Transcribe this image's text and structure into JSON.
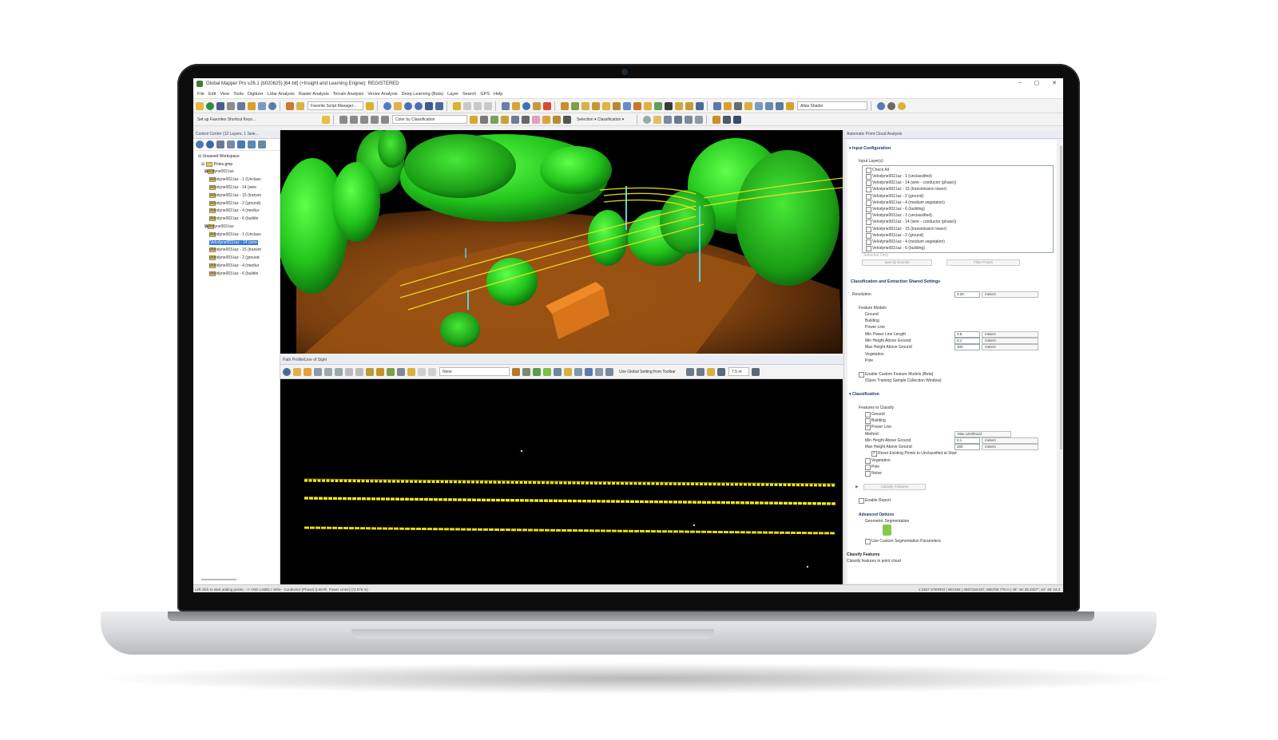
{
  "window": {
    "title": "Global Mapper Pro v26.1 (b020625) [64 bit] (+Insight and Learning Engine): REGISTERED",
    "controls": [
      "–",
      "▢",
      "✕"
    ]
  },
  "menu": [
    "File",
    "Edit",
    "View",
    "Tools",
    "Digitizer",
    "Lidar Analysis",
    "Raster Analysis",
    "Terrain Analysis",
    "Vector Analysis",
    "Deep Learning (Beta)",
    "Layer",
    "Search",
    "GPS",
    "Help"
  ],
  "toolbar": {
    "script_manager": "Favorite Script Manager...",
    "shortcut_keys": "Set up Favorites Shortcut Keys...",
    "color_by": "Color by Classification",
    "selection": "Selection",
    "classification": "Classification",
    "shader": "Atlas Shader"
  },
  "control_center": {
    "title": "Control Center (12 Layers, 1 Sele...",
    "workspace": "Unsaved Workspace",
    "group": "Poles.gmp",
    "layers": [
      {
        "name": "Velodyne002.laz",
        "indent": 2,
        "selected": false
      },
      {
        "name": "Velodyne002.laz - 1 (Unclass",
        "indent": 3,
        "selected": false
      },
      {
        "name": "Velodyne002.laz - 14 (wire",
        "indent": 3,
        "selected": false
      },
      {
        "name": "Velodyne002.laz - 15 (transm",
        "indent": 3,
        "selected": false
      },
      {
        "name": "Velodyne002.laz - 2 (ground)",
        "indent": 3,
        "selected": false
      },
      {
        "name": "Velodyne002.laz - 4 (mediur",
        "indent": 3,
        "selected": false
      },
      {
        "name": "Velodyne002.laz - 6 (buildin",
        "indent": 3,
        "selected": false
      },
      {
        "name": "Velodyne003.laz",
        "indent": 2,
        "selected": false
      },
      {
        "name": "Velodyne003.laz - 1 (Unclass",
        "indent": 3,
        "selected": false
      },
      {
        "name": "Velodyne003.laz - 14 (wire",
        "indent": 3,
        "selected": true
      },
      {
        "name": "Velodyne003.laz - 15 (transm",
        "indent": 3,
        "selected": false
      },
      {
        "name": "Velodyne003.laz - 2 (ground",
        "indent": 3,
        "selected": false
      },
      {
        "name": "Velodyne003.laz - 4 (mediur",
        "indent": 3,
        "selected": false
      },
      {
        "name": "Velodyne003.laz - 6 (buildin",
        "indent": 3,
        "selected": false
      }
    ]
  },
  "profile": {
    "title": "Path Profile/Line of Sight",
    "none": "None",
    "global_setting": "Use Global Setting from Toolbar",
    "spacing": "7.5 m"
  },
  "analysis": {
    "title": "Automatic Point Cloud Analysis",
    "input_config": "Input Configuration",
    "input_layers_label": "Input Layer(s)",
    "check_all": "Check All",
    "input_layers": [
      "Velodyne002.laz - 1 (unclassified)",
      "Velodyne002.laz - 14 (wire - conductor (phase))",
      "Velodyne002.laz - 15 (transmission tower)",
      "Velodyne002.laz - 2 (ground)",
      "Velodyne002.laz - 4 (medium vegetation)",
      "Velodyne002.laz - 6 (building)",
      "Velodyne003.laz - 1 (unclassified)",
      "Velodyne003.laz - 14 (wire - conductor (phase))",
      "Velodyne003.laz - 15 (transmission tower)",
      "Velodyne003.laz - 2 (ground)",
      "Velodyne003.laz - 4 (medium vegetation)",
      "Velodyne003.laz - 6 (building)"
    ],
    "selected_only": "Selected Only",
    "specify_bounds": "Specify Bounds",
    "filter_points": "Filter Points",
    "shared_settings": "Classification and Extraction Shared Settings",
    "resolution_label": "Resolution",
    "resolution_value": "0.25",
    "units": "meters",
    "feature_models": "Feature Models",
    "fm_ground": "Ground",
    "fm_building": "Building",
    "fm_power_line": "Power Line",
    "min_line_length": "Min Power Line Length",
    "min_line_length_value": "0.5",
    "min_height": "Min Height Above Ground",
    "min_height_value": "0.1",
    "max_height": "Max Height Above Ground",
    "max_height_value": "300",
    "fm_vegetation": "Vegetation",
    "fm_pole": "Pole",
    "custom_models": "Enable Custom Feature Models (Beta)",
    "training_window": "(Open Training Sample Collection Window)",
    "classification": "Classification",
    "features_to_classify": "Features to Classify",
    "f_ground": "Ground",
    "f_building": "Building",
    "f_power_line": "Power Line",
    "method_label": "Method",
    "method_value": "Max Likelihood",
    "c_min_height_value": "0.1",
    "c_max_height_value": "300",
    "reset_points": "Reset Existing Points to Unclassified at Start",
    "f_vegetation": "Vegetation",
    "f_pole": "Pole",
    "f_noise": "Noise",
    "classify_button": "Classify Features",
    "enable_report": "Enable Report",
    "advanced": "Advanced Options",
    "geo_seg": "Geometric Segmentation",
    "custom_seg": "Use Custom Segmentation Parameters",
    "help_title": "Classify Features",
    "help_text": "Classify features in point cloud"
  },
  "status": {
    "left": "Left click to start adding points. --> <NO LABEL> Wire - Conductor (Phase) [LIDAR, Power Lines] (73.676 m)",
    "right": "1:2457 STEREO | WGS84 | 3067318.537, 656788.779 m | 46° 46' 25.3327\", 44° 46' 44.3"
  },
  "colors": {
    "vegetation": "#22c41c",
    "ground": "#8a4a12",
    "wire": "#f1e51a",
    "selection": "#3478d4"
  }
}
